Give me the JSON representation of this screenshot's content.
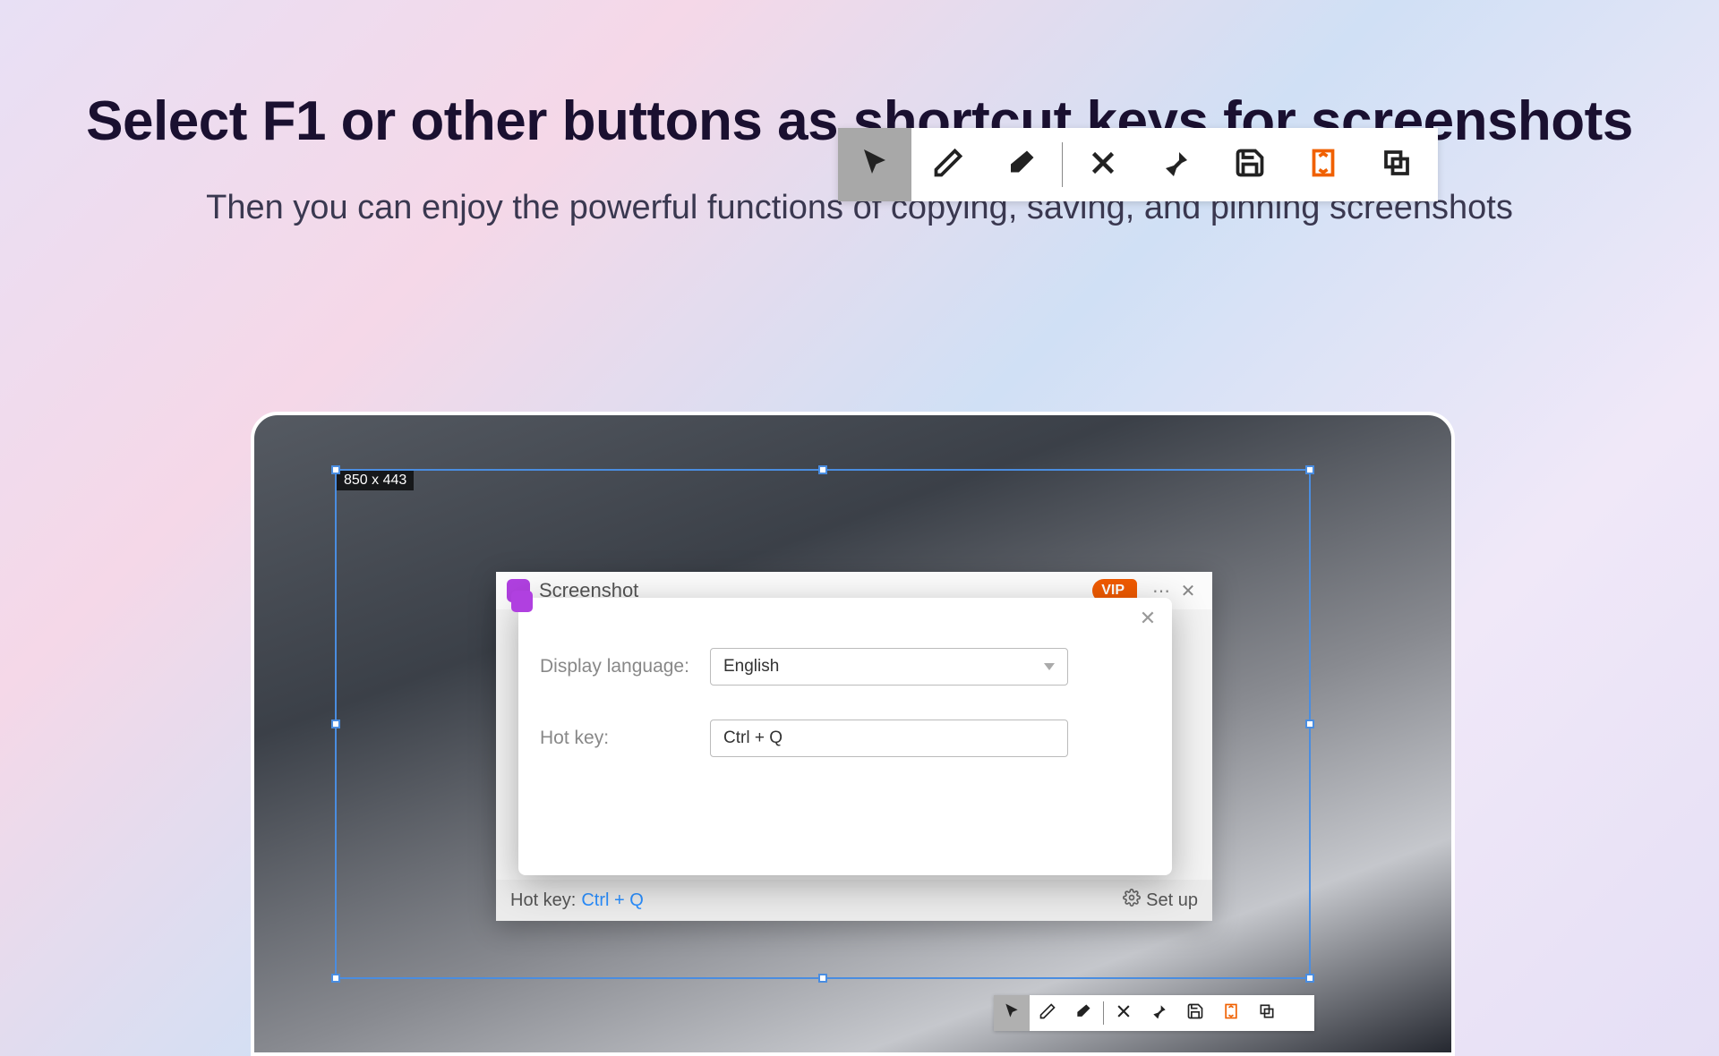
{
  "page": {
    "title": "Select F1 or other buttons as shortcut keys for screenshots",
    "subtitle": "Then you can enjoy the powerful functions of copying, saving, and pinning screenshots"
  },
  "selection": {
    "dimensions": "850 x 443"
  },
  "toolbar": {
    "items": [
      "cursor",
      "pencil",
      "eraser",
      "close",
      "pin",
      "save",
      "long-screenshot",
      "copy"
    ]
  },
  "main_window": {
    "title": "Screenshot",
    "badge": "VIP",
    "footer_label": "Hot key:",
    "footer_value": "Ctrl + Q",
    "setup_label": "Set up"
  },
  "settings": {
    "lang_label": "Display language:",
    "lang_value": "English",
    "hotkey_label": "Hot key:",
    "hotkey_value": "Ctrl + Q"
  }
}
